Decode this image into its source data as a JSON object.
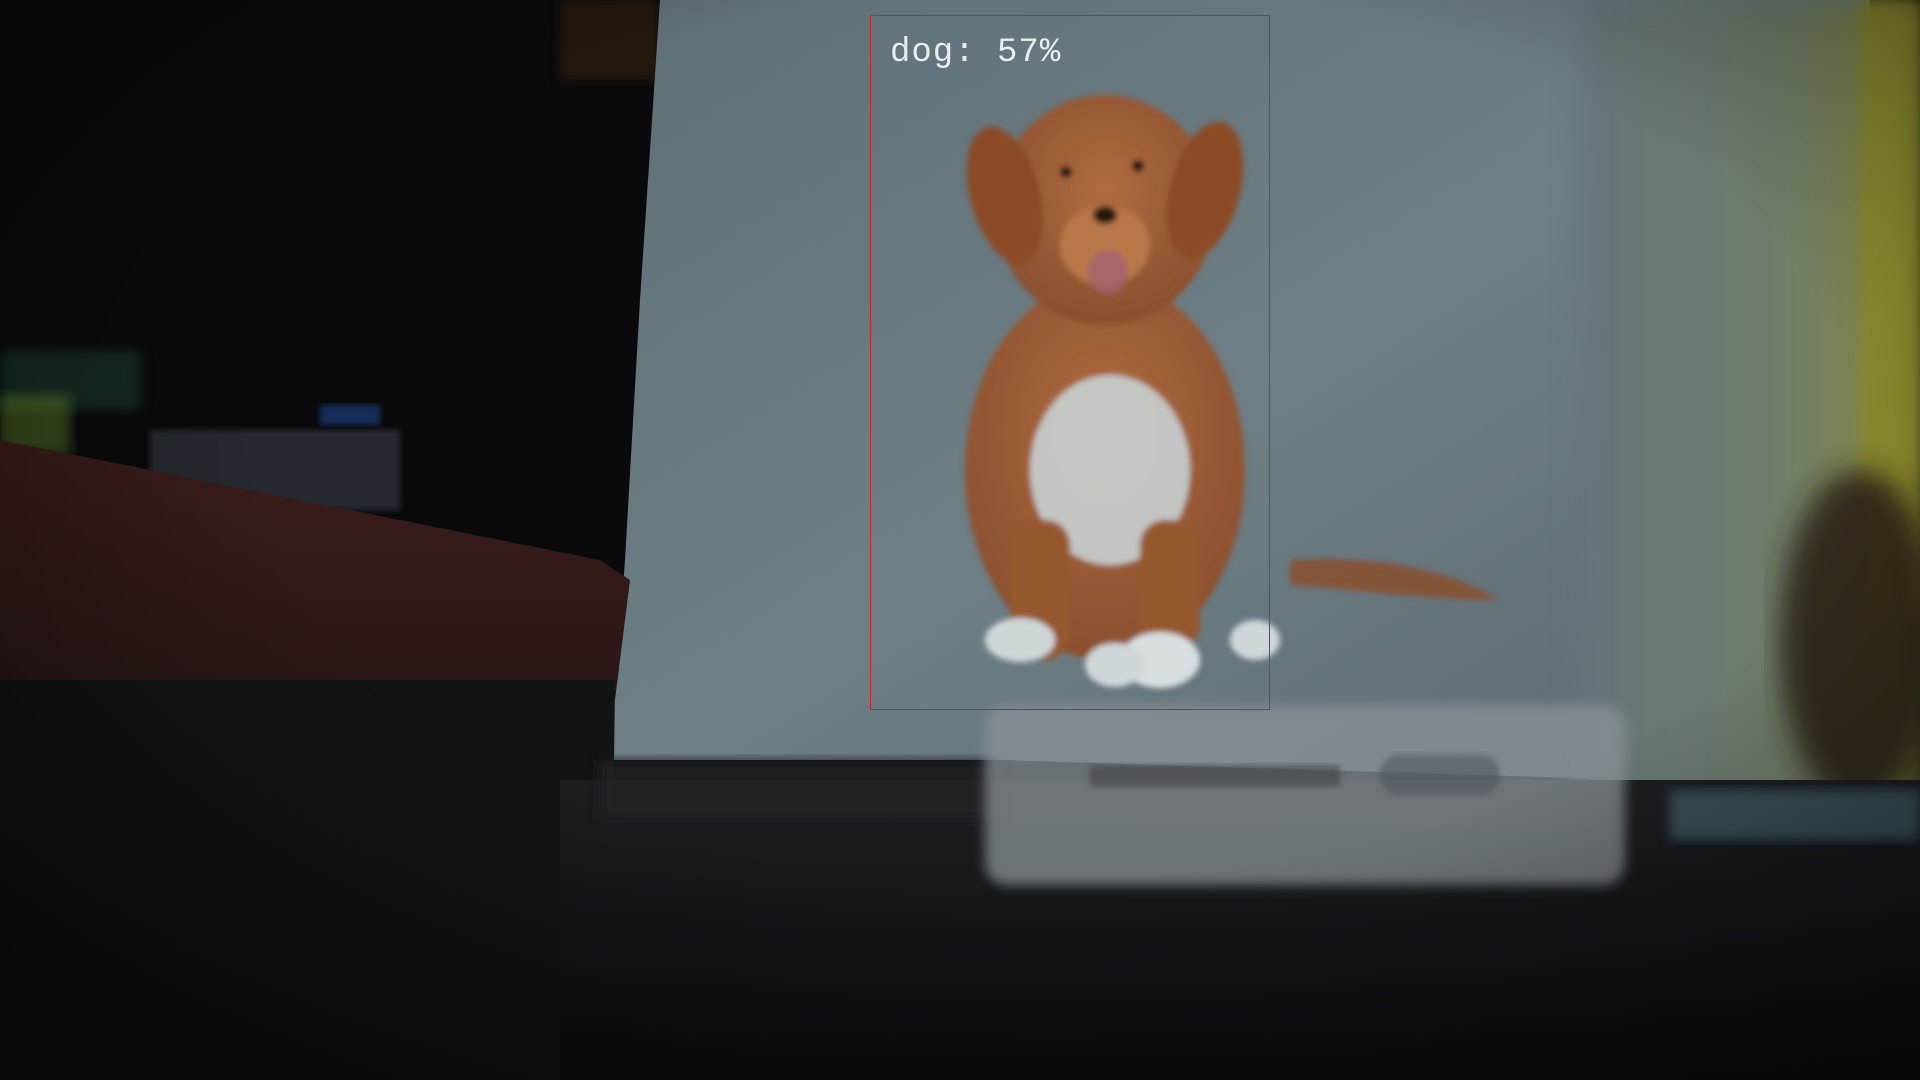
{
  "detection": {
    "label": "dog: 57%",
    "box_color": "#c8222a",
    "text_color": "#e6ecef"
  },
  "scene": {
    "subject": "dog-photo",
    "palette": {
      "background_dark": "#0a0a0c",
      "paper": "#6c7c83",
      "dog_fur": "#a0603a",
      "table_red": "#3a1c1a",
      "wall_right": "#7a8a70"
    }
  }
}
